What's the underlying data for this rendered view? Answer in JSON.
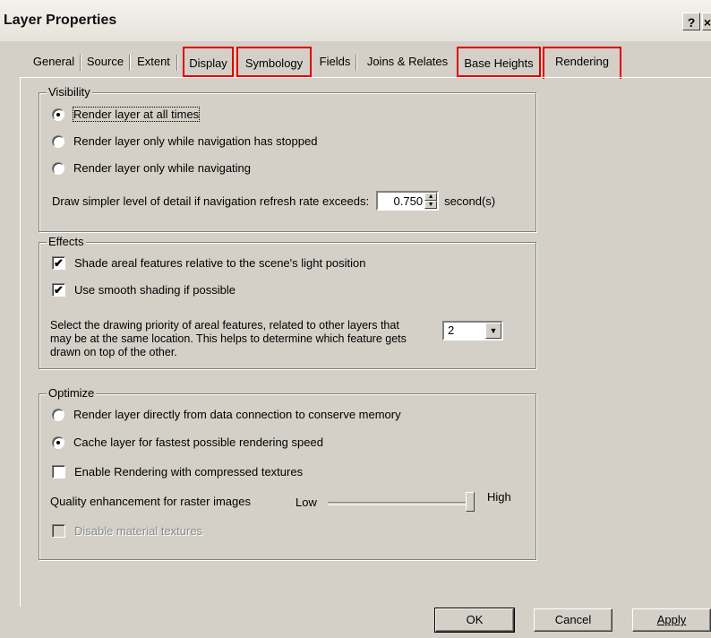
{
  "window": {
    "title": "Layer Properties",
    "help_label": "?",
    "close_label": "×"
  },
  "tabs": [
    {
      "label": "General"
    },
    {
      "label": "Source"
    },
    {
      "label": "Extent"
    },
    {
      "label": "Display"
    },
    {
      "label": "Symbology"
    },
    {
      "label": "Fields"
    },
    {
      "label": "Joins & Relates"
    },
    {
      "label": "Base Heights"
    },
    {
      "label": "Rendering"
    }
  ],
  "visibility": {
    "legend": "Visibility",
    "options": [
      "Render layer at all times",
      "Render layer only while navigation has stopped",
      "Render layer only while navigating"
    ],
    "selected": 0,
    "refresh_label": "Draw simpler level of detail if navigation refresh rate exceeds:",
    "refresh_value": "0.750",
    "refresh_unit": "second(s)"
  },
  "effects": {
    "legend": "Effects",
    "shade_label": "Shade areal features relative to the scene's light position",
    "shade_checked": "✔",
    "smooth_label": "Use smooth shading if possible",
    "smooth_checked": "✔",
    "priority_text": "Select the drawing priority of areal features, related to other layers that may be at the same location. This helps to determine which feature gets drawn on top of the other.",
    "priority_value": "2"
  },
  "optimize": {
    "legend": "Optimize",
    "options": [
      "Render layer directly from data connection to conserve memory",
      "Cache layer for fastest possible rendering speed"
    ],
    "selected": 1,
    "compressed_label": "Enable Rendering with compressed textures",
    "quality_label": "Quality enhancement for raster images",
    "quality_low": "Low",
    "quality_high": "High",
    "quality_level": 1.0,
    "disable_textures_label": "Disable material textures"
  },
  "buttons": {
    "ok": "OK",
    "cancel": "Cancel",
    "apply": "Apply"
  }
}
